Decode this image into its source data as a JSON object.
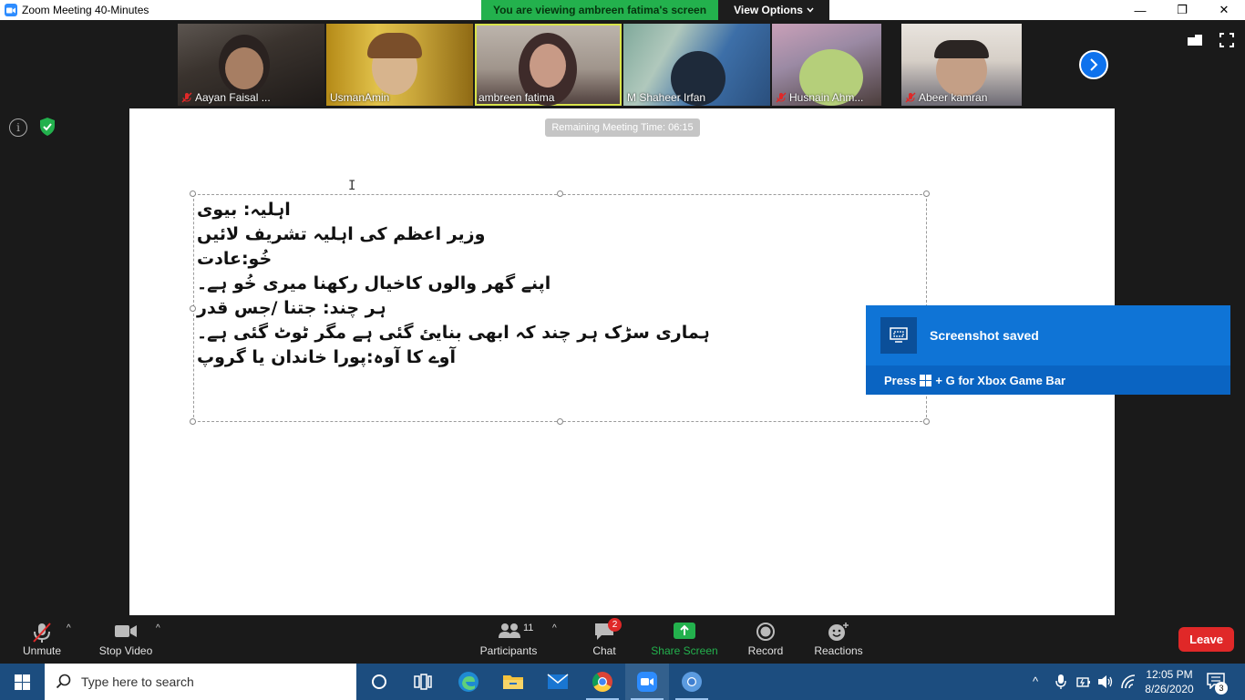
{
  "window": {
    "title": "Zoom Meeting 40-Minutes",
    "minimize": "—",
    "restore": "❐",
    "close": "✕"
  },
  "banner": {
    "message": "You are viewing ambreen fatima's screen",
    "view_options": "View Options"
  },
  "participants_strip": [
    {
      "name": "Aayan Faisal ...",
      "muted": true
    },
    {
      "name": "UsmanAmin",
      "muted": false
    },
    {
      "name": "ambreen fatima",
      "muted": false,
      "active": true
    },
    {
      "name": "M Shaheer Irfan",
      "muted": false
    },
    {
      "name": "Husnain Ahm...",
      "muted": true
    },
    {
      "name": "Abeer kamran",
      "muted": true
    }
  ],
  "shared_screen": {
    "remaining_time": "Remaining Meeting Time: 06:15",
    "lines": [
      "اہلیہ: بیوی",
      "وزیر اعظم کی اہلیہ تشریف لائیں",
      "خُو:عادت",
      "اپنے گھر والوں کاخیال رکھنا میری خُو ہے۔",
      "ہر چند: جتنا /جس قدر",
      "ہماری سڑک ہر چند کہ ابھی بنایئ گئی ہے مگر ٹوٹ گئی ہے۔",
      "آوے کا آوہ:پورا خاندان یا گروپ"
    ]
  },
  "toast": {
    "title": "Screenshot saved",
    "press": "Press",
    "shortcut": "+ G for Xbox Game Bar"
  },
  "controls": {
    "unmute": "Unmute",
    "stop_video": "Stop Video",
    "participants": "Participants",
    "participants_count": "11",
    "chat": "Chat",
    "chat_badge": "2",
    "share_screen": "Share Screen",
    "record": "Record",
    "reactions": "Reactions",
    "leave": "Leave"
  },
  "taskbar": {
    "search_placeholder": "Type here to search",
    "time": "12:05 PM",
    "date": "8/26/2020",
    "notification_count": "3"
  },
  "colors": {
    "zoom_blue": "#0e72ed",
    "banner_green": "#23b14d",
    "leave_red": "#e02828",
    "taskbar": "#1c4d7f",
    "toast": "#0f74d6"
  }
}
